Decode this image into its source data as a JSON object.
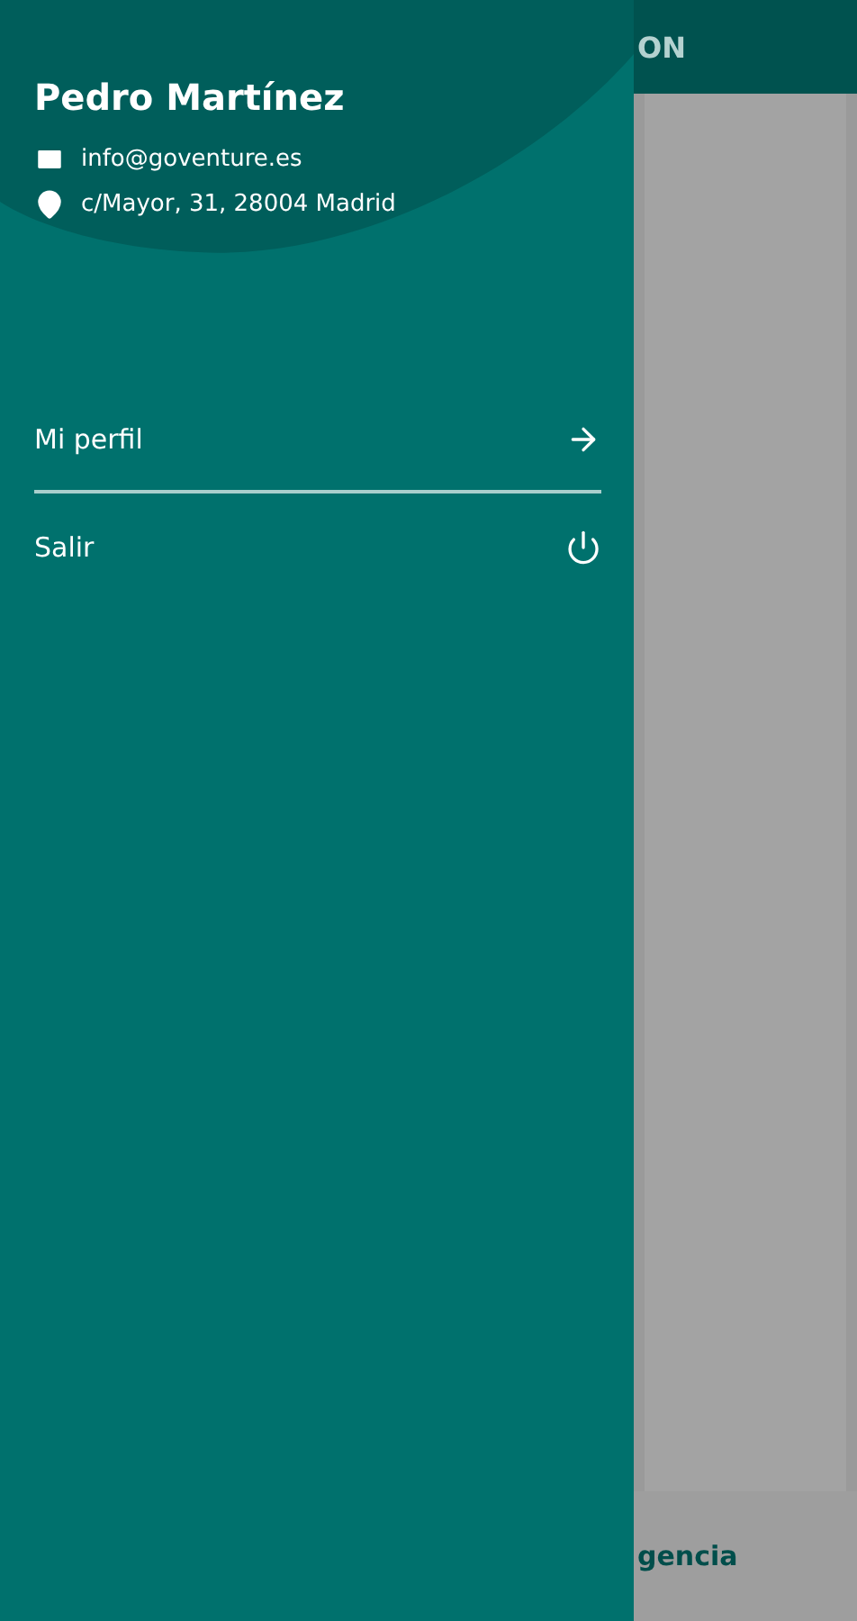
{
  "background_screen": {
    "header_title": "ON",
    "bottom_tab": "gencia"
  },
  "drawer": {
    "user": {
      "name": "Pedro Martínez",
      "email": "info@goventure.es",
      "address": "c/Mayor, 31, 28004 Madrid"
    },
    "menu": [
      {
        "label": "Mi perfil",
        "kind": "arrow"
      },
      {
        "label": "Salir",
        "kind": "power"
      }
    ]
  }
}
